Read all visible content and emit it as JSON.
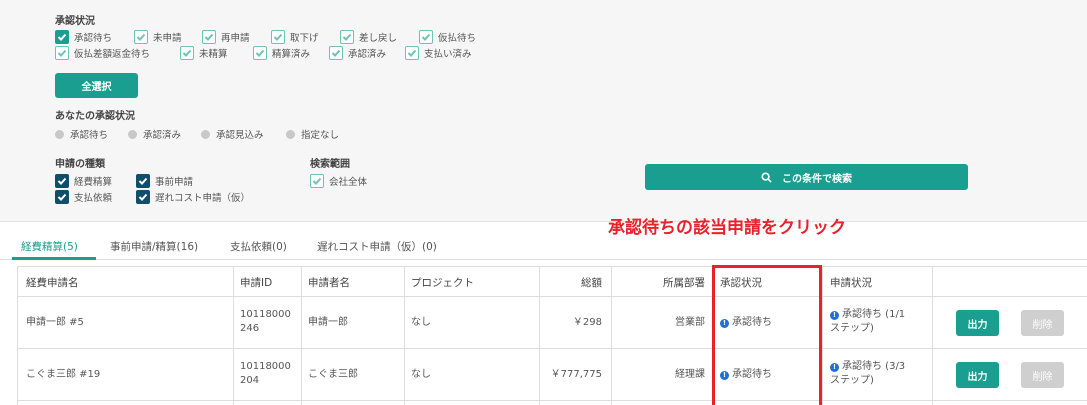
{
  "filters": {
    "approval_status_label": "承認状況",
    "approval_status_options": [
      {
        "label": "承認待ち",
        "checked": true
      },
      {
        "label": "未申請",
        "checked": false
      },
      {
        "label": "再申請",
        "checked": false
      },
      {
        "label": "取下げ",
        "checked": false
      },
      {
        "label": "差し戻し",
        "checked": false
      },
      {
        "label": "仮払待ち",
        "checked": false
      },
      {
        "label": "仮払差額返金待ち",
        "checked": false
      },
      {
        "label": "未精算",
        "checked": false
      },
      {
        "label": "精算済み",
        "checked": false
      },
      {
        "label": "承認済み",
        "checked": false
      },
      {
        "label": "支払い済み",
        "checked": false
      }
    ],
    "select_all_label": "全選択",
    "your_status_label": "あなたの承認状況",
    "your_status_options": [
      "承認待ち",
      "承認済み",
      "承認見込み",
      "指定なし"
    ],
    "type_label": "申請の種類",
    "type_options": [
      {
        "label": "経費精算",
        "checked": true
      },
      {
        "label": "事前申請",
        "checked": true
      },
      {
        "label": "支払依頼",
        "checked": true
      },
      {
        "label": "遅れコスト申請（仮）",
        "checked": true
      }
    ],
    "scope_label": "検索範囲",
    "scope_option": "会社全体",
    "search_button": "この条件で検索"
  },
  "annotation": "承認待ちの該当申請をクリック",
  "tabs": [
    "経費精算(5)",
    "事前申請/精算(16)",
    "支払依頼(0)",
    "遅れコスト申請（仮）(0)"
  ],
  "table": {
    "headers": [
      "経費申請名",
      "申請ID",
      "申請者名",
      "プロジェクト",
      "総額",
      "所属部署",
      "承認状況",
      "申請状況"
    ],
    "rows": [
      {
        "name": "申請一郎 #5",
        "id_line1": "10118000",
        "id_line2": "246",
        "applicant": "申請一郎",
        "project": "なし",
        "total": "￥298",
        "dept": "営業部",
        "approval": "承認待ち",
        "status_line1": "承認待ち (1/1",
        "status_line2": "ステップ)",
        "output": "出力",
        "delete": "削除"
      },
      {
        "name": "こぐま三郎 #19",
        "id_line1": "10118000",
        "id_line2": "204",
        "applicant": "こぐま三郎",
        "project": "なし",
        "total": "￥777,775",
        "dept": "経理課",
        "approval": "承認待ち",
        "status_line1": "承認待ち (3/3",
        "status_line2": "ステップ)",
        "output": "出力",
        "delete": "削除"
      }
    ]
  }
}
